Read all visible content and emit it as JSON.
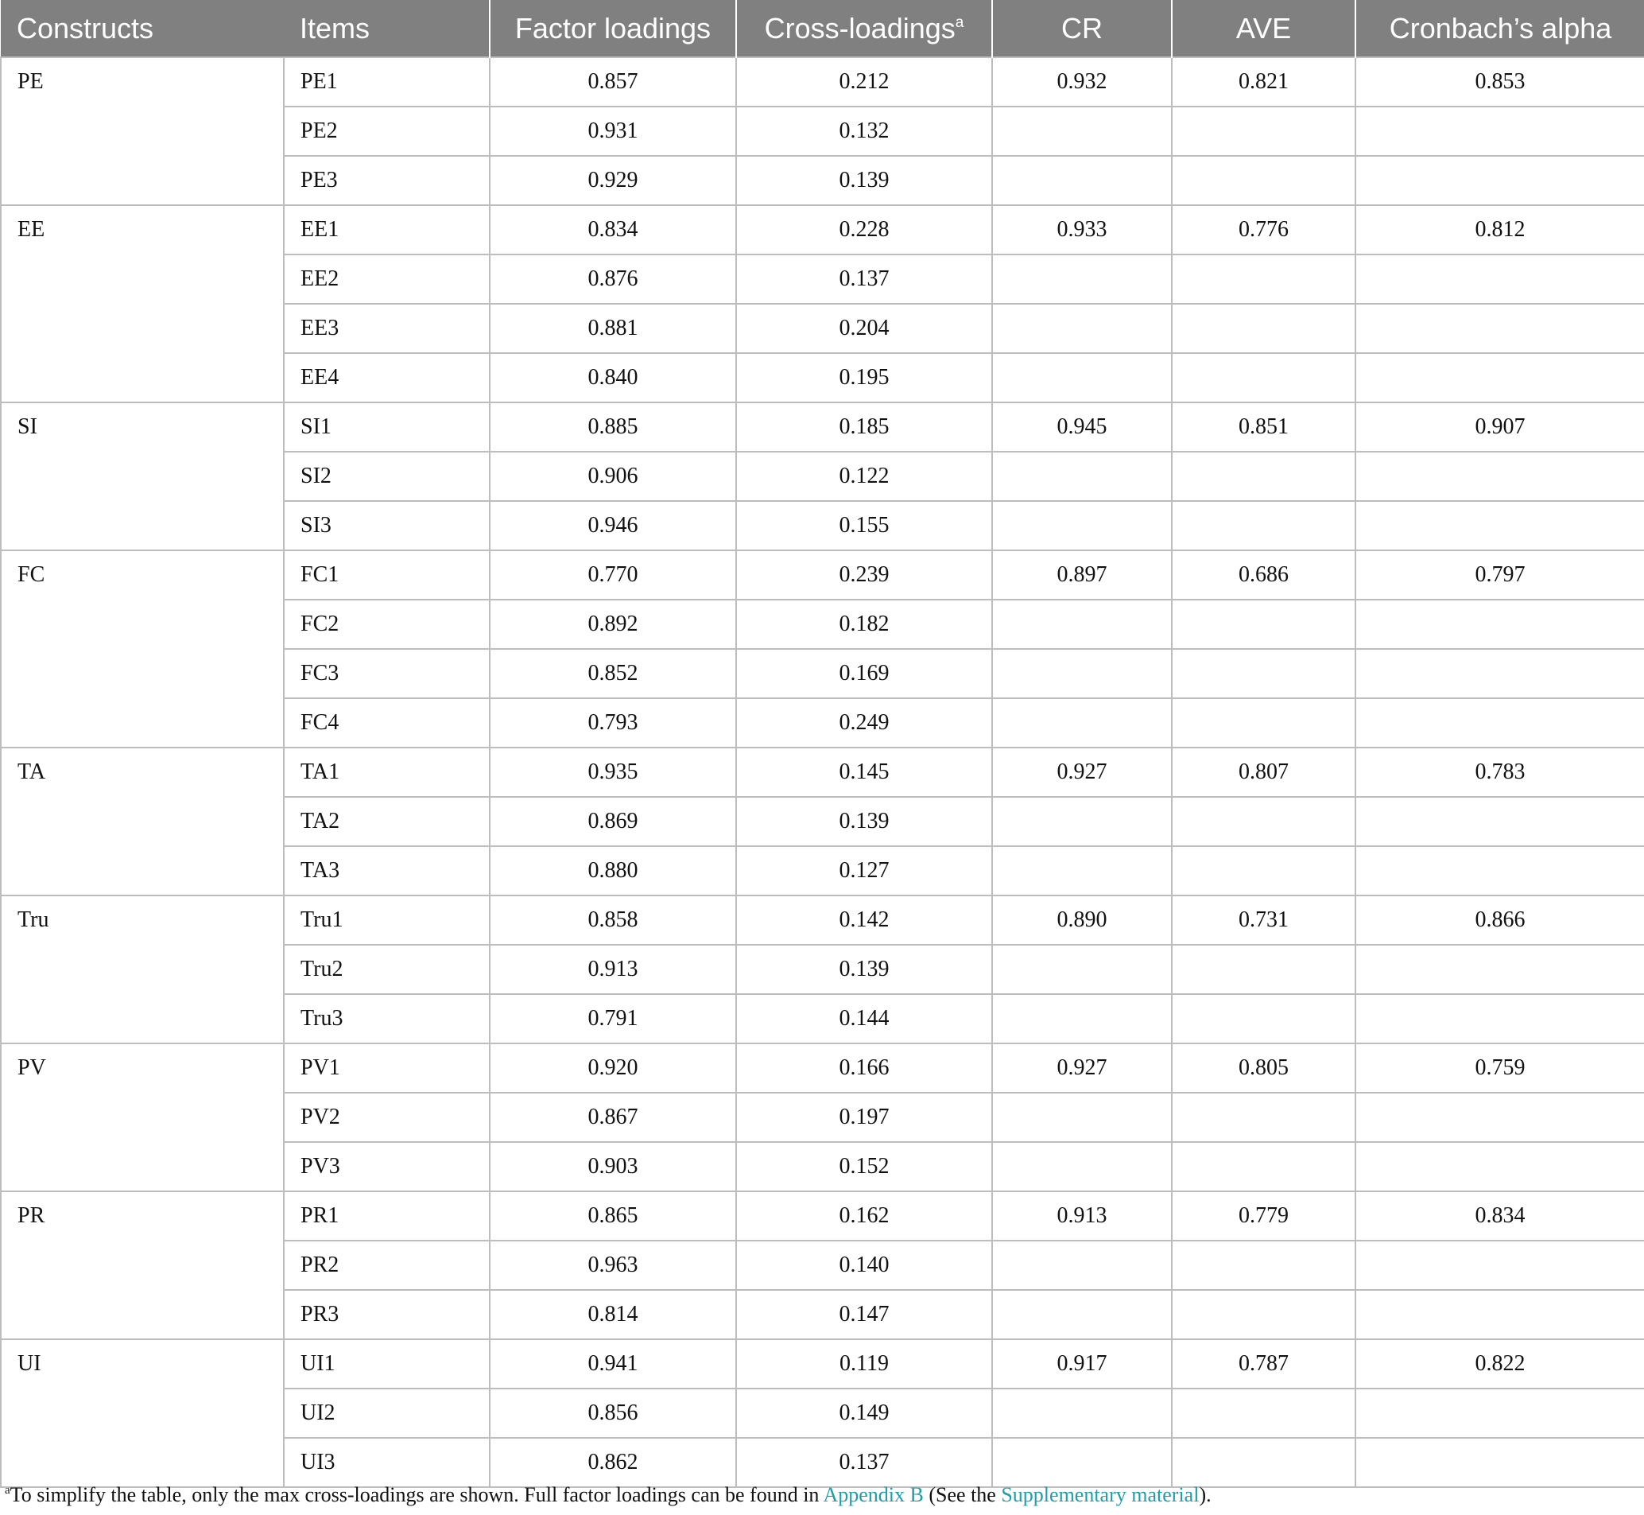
{
  "table": {
    "headers": {
      "constructs": "Constructs",
      "items": "Items",
      "factor_loadings": "Factor loadings",
      "cross_loadings": "Cross-loadings",
      "cross_loadings_mark": "a",
      "cr": "CR",
      "ave": "AVE",
      "alpha": "Cronbach’s alpha"
    },
    "groups": [
      {
        "construct": "PE",
        "cr": "0.932",
        "ave": "0.821",
        "alpha": "0.853",
        "rows": [
          {
            "item": "PE1",
            "loading": "0.857",
            "cross": "0.212"
          },
          {
            "item": "PE2",
            "loading": "0.931",
            "cross": "0.132"
          },
          {
            "item": "PE3",
            "loading": "0.929",
            "cross": "0.139"
          }
        ]
      },
      {
        "construct": "EE",
        "cr": "0.933",
        "ave": "0.776",
        "alpha": "0.812",
        "rows": [
          {
            "item": "EE1",
            "loading": "0.834",
            "cross": "0.228"
          },
          {
            "item": "EE2",
            "loading": "0.876",
            "cross": "0.137"
          },
          {
            "item": "EE3",
            "loading": "0.881",
            "cross": "0.204"
          },
          {
            "item": "EE4",
            "loading": "0.840",
            "cross": "0.195"
          }
        ]
      },
      {
        "construct": "SI",
        "cr": "0.945",
        "ave": "0.851",
        "alpha": "0.907",
        "rows": [
          {
            "item": "SI1",
            "loading": "0.885",
            "cross": "0.185"
          },
          {
            "item": "SI2",
            "loading": "0.906",
            "cross": "0.122"
          },
          {
            "item": "SI3",
            "loading": "0.946",
            "cross": "0.155"
          }
        ]
      },
      {
        "construct": "FC",
        "cr": "0.897",
        "ave": "0.686",
        "alpha": "0.797",
        "rows": [
          {
            "item": "FC1",
            "loading": "0.770",
            "cross": "0.239"
          },
          {
            "item": "FC2",
            "loading": "0.892",
            "cross": "0.182"
          },
          {
            "item": "FC3",
            "loading": "0.852",
            "cross": "0.169"
          },
          {
            "item": "FC4",
            "loading": "0.793",
            "cross": "0.249"
          }
        ]
      },
      {
        "construct": "TA",
        "cr": "0.927",
        "ave": "0.807",
        "alpha": "0.783",
        "rows": [
          {
            "item": "TA1",
            "loading": "0.935",
            "cross": "0.145"
          },
          {
            "item": "TA2",
            "loading": "0.869",
            "cross": "0.139"
          },
          {
            "item": "TA3",
            "loading": "0.880",
            "cross": "0.127"
          }
        ]
      },
      {
        "construct": "Tru",
        "cr": "0.890",
        "ave": "0.731",
        "alpha": "0.866",
        "rows": [
          {
            "item": "Tru1",
            "loading": "0.858",
            "cross": "0.142"
          },
          {
            "item": "Tru2",
            "loading": "0.913",
            "cross": "0.139"
          },
          {
            "item": "Tru3",
            "loading": "0.791",
            "cross": "0.144"
          }
        ]
      },
      {
        "construct": "PV",
        "cr": "0.927",
        "ave": "0.805",
        "alpha": "0.759",
        "rows": [
          {
            "item": "PV1",
            "loading": "0.920",
            "cross": "0.166"
          },
          {
            "item": "PV2",
            "loading": "0.867",
            "cross": "0.197"
          },
          {
            "item": "PV3",
            "loading": "0.903",
            "cross": "0.152"
          }
        ]
      },
      {
        "construct": "PR",
        "cr": "0.913",
        "ave": "0.779",
        "alpha": "0.834",
        "rows": [
          {
            "item": "PR1",
            "loading": "0.865",
            "cross": "0.162"
          },
          {
            "item": "PR2",
            "loading": "0.963",
            "cross": "0.140"
          },
          {
            "item": "PR3",
            "loading": "0.814",
            "cross": "0.147"
          }
        ]
      },
      {
        "construct": "UI",
        "cr": "0.917",
        "ave": "0.787",
        "alpha": "0.822",
        "rows": [
          {
            "item": "UI1",
            "loading": "0.941",
            "cross": "0.119"
          },
          {
            "item": "UI2",
            "loading": "0.856",
            "cross": "0.149"
          },
          {
            "item": "UI3",
            "loading": "0.862",
            "cross": "0.137"
          }
        ]
      }
    ]
  },
  "footnote": {
    "mark": "a",
    "text_1": "To simplify the table, only the max cross-loadings are shown. Full factor loadings can be found in ",
    "link_1": "Appendix B",
    "text_2": " (See the ",
    "link_2": "Supplementary material",
    "text_3": ")."
  },
  "colors": {
    "header_bg": "#808080",
    "header_text": "#ffffff",
    "grid": "#bdbdbd",
    "link": "#1d9fa8"
  }
}
